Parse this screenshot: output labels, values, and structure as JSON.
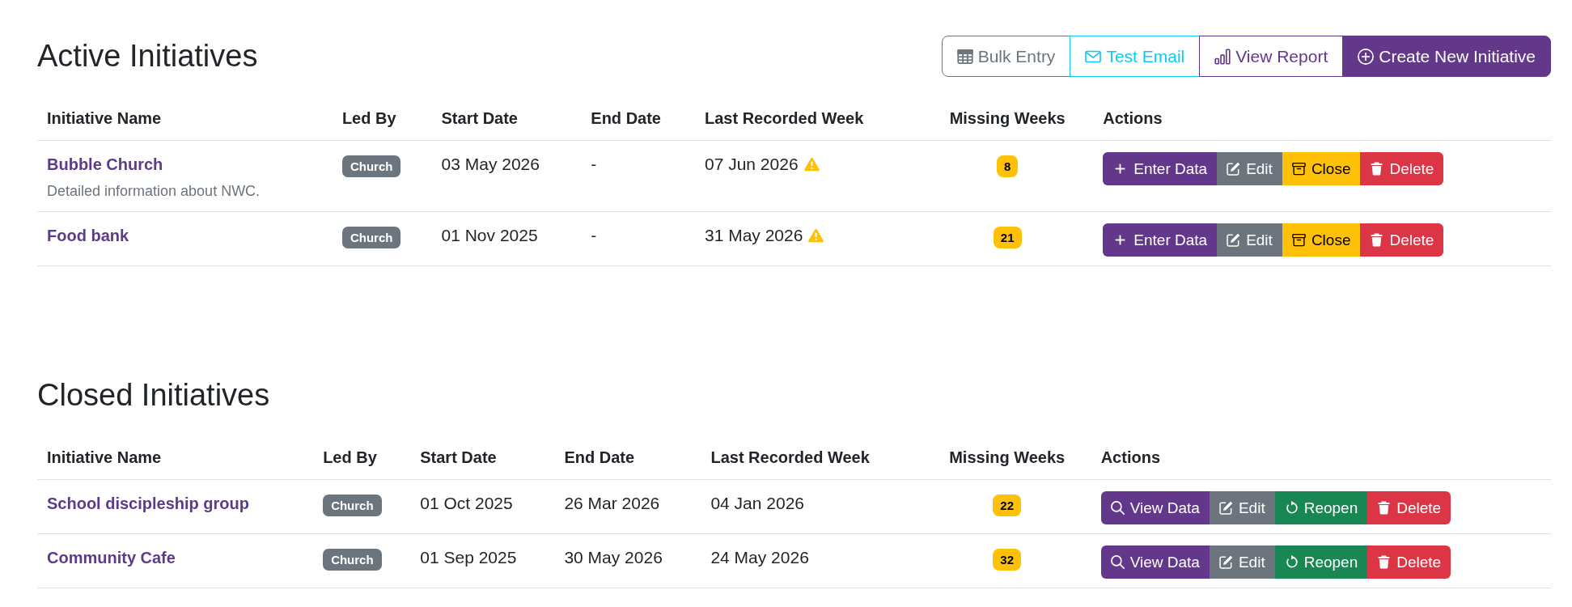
{
  "sections": [
    {
      "title": "Active Initiatives",
      "buttons": [
        {
          "label": "Bulk Entry",
          "kind": "bulk"
        },
        {
          "label": "Test Email",
          "kind": "email"
        },
        {
          "label": "View Report",
          "kind": "report"
        },
        {
          "label": "Create New Initiative",
          "kind": "create"
        }
      ],
      "columns": [
        "Initiative Name",
        "Led By",
        "Start Date",
        "End Date",
        "Last Recorded Week",
        "Missing Weeks",
        "Actions"
      ],
      "rows": [
        {
          "name": "Bubble Church",
          "description": "Detailed information about NWC.",
          "led_by": "Church",
          "start_date": "03 May 2026",
          "end_date": "-",
          "last_recorded_week": "07 Jun 2026",
          "warning": true,
          "missing_weeks": "8",
          "actions": [
            {
              "label": "Enter Data",
              "kind": "enter"
            },
            {
              "label": "Edit",
              "kind": "edit"
            },
            {
              "label": "Close",
              "kind": "close"
            },
            {
              "label": "Delete",
              "kind": "delete"
            }
          ]
        },
        {
          "name": "Food bank",
          "led_by": "Church",
          "start_date": "01 Nov 2025",
          "end_date": "-",
          "last_recorded_week": "31 May 2026",
          "warning": true,
          "missing_weeks": "21",
          "actions": [
            {
              "label": "Enter Data",
              "kind": "enter"
            },
            {
              "label": "Edit",
              "kind": "edit"
            },
            {
              "label": "Close",
              "kind": "close"
            },
            {
              "label": "Delete",
              "kind": "delete"
            }
          ]
        }
      ]
    },
    {
      "title": "Closed Initiatives",
      "columns": [
        "Initiative Name",
        "Led By",
        "Start Date",
        "End Date",
        "Last Recorded Week",
        "Missing Weeks",
        "Actions"
      ],
      "rows": [
        {
          "name": "School discipleship group",
          "led_by": "Church",
          "start_date": "01 Oct 2025",
          "end_date": "26 Mar 2026",
          "last_recorded_week": "04 Jan 2026",
          "warning": false,
          "missing_weeks": "22",
          "actions": [
            {
              "label": "View Data",
              "kind": "view"
            },
            {
              "label": "Edit",
              "kind": "edit"
            },
            {
              "label": "Reopen",
              "kind": "reopen"
            },
            {
              "label": "Delete",
              "kind": "delete"
            }
          ]
        },
        {
          "name": "Community Cafe",
          "led_by": "Church",
          "start_date": "01 Sep 2025",
          "end_date": "30 May 2026",
          "last_recorded_week": "24 May 2026",
          "warning": false,
          "missing_weeks": "32",
          "actions": [
            {
              "label": "View Data",
              "kind": "view"
            },
            {
              "label": "Edit",
              "kind": "edit"
            },
            {
              "label": "Reopen",
              "kind": "reopen"
            },
            {
              "label": "Delete",
              "kind": "delete"
            }
          ]
        }
      ]
    }
  ]
}
